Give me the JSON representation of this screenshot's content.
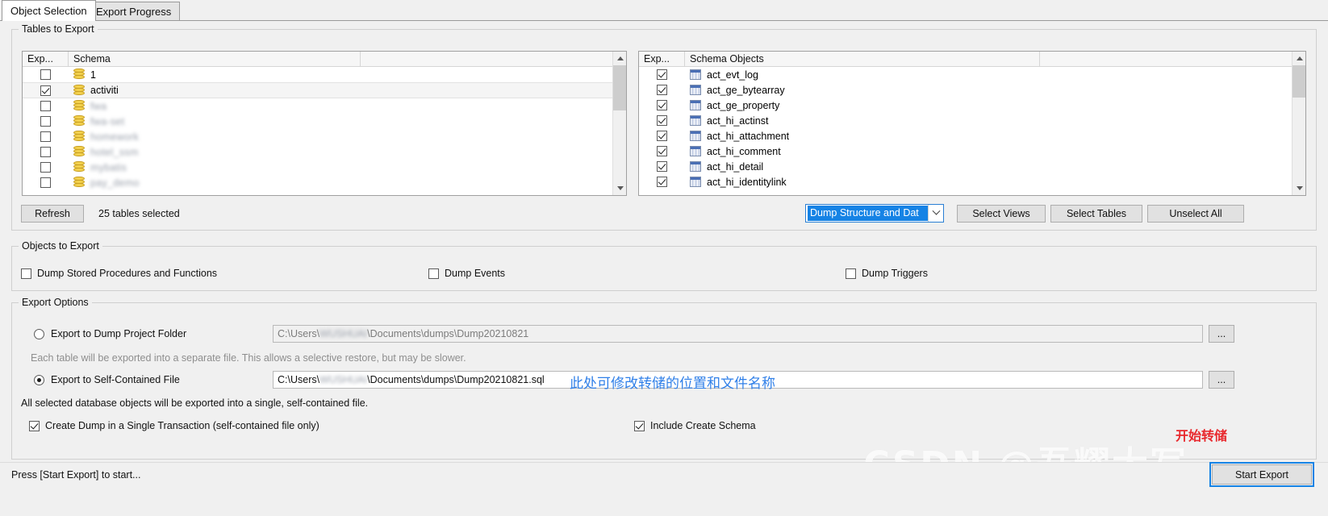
{
  "tabs": [
    {
      "label": "Object Selection",
      "active": true
    },
    {
      "label": "Export Progress",
      "active": false
    }
  ],
  "groups": {
    "tables_to_export": "Tables to Export",
    "objects_to_export": "Objects to Export",
    "export_options": "Export Options"
  },
  "schema_list": {
    "header_export": "Exp...",
    "header_name": "Schema",
    "rows": [
      {
        "name": "1",
        "checked": false,
        "selected": false,
        "blurred": false
      },
      {
        "name": "activiti",
        "checked": true,
        "selected": true,
        "blurred": false
      },
      {
        "name": "fwa",
        "checked": false,
        "selected": false,
        "blurred": true
      },
      {
        "name": "fwa-set",
        "checked": false,
        "selected": false,
        "blurred": true
      },
      {
        "name": "homework",
        "checked": false,
        "selected": false,
        "blurred": true
      },
      {
        "name": "hotel_ssm",
        "checked": false,
        "selected": false,
        "blurred": true
      },
      {
        "name": "mybatis",
        "checked": false,
        "selected": false,
        "blurred": true
      },
      {
        "name": "pay_demo",
        "checked": false,
        "selected": false,
        "blurred": true
      }
    ]
  },
  "objects_list": {
    "header_export": "Exp...",
    "header_name": "Schema Objects",
    "rows": [
      {
        "name": "act_evt_log",
        "checked": true
      },
      {
        "name": "act_ge_bytearray",
        "checked": true
      },
      {
        "name": "act_ge_property",
        "checked": true
      },
      {
        "name": "act_hi_actinst",
        "checked": true
      },
      {
        "name": "act_hi_attachment",
        "checked": true
      },
      {
        "name": "act_hi_comment",
        "checked": true
      },
      {
        "name": "act_hi_detail",
        "checked": true
      },
      {
        "name": "act_hi_identitylink",
        "checked": true
      }
    ]
  },
  "toolbar": {
    "refresh_label": "Refresh",
    "tables_selected": "25 tables selected",
    "dump_mode_value": "Dump Structure and Dat",
    "select_views_label": "Select Views",
    "select_tables_label": "Select Tables",
    "unselect_all_label": "Unselect All"
  },
  "objects_options": [
    {
      "label": "Dump Stored Procedures and Functions",
      "checked": false
    },
    {
      "label": "Dump Events",
      "checked": false
    },
    {
      "label": "Dump Triggers",
      "checked": false
    }
  ],
  "export_options": {
    "project_folder": {
      "radio_label": "Export to Dump Project Folder",
      "selected": false,
      "path_prefix": "C:\\Users\\",
      "path_user": "WUSHUAI",
      "path_suffix": "\\Documents\\dumps\\Dump20210821",
      "browse_label": "...",
      "help": "Each table will be exported into a separate file. This allows a selective restore, but may be slower."
    },
    "self_contained": {
      "radio_label": "Export to Self-Contained File",
      "selected": true,
      "path_prefix": "C:\\Users\\",
      "path_user": "WUSHUAI",
      "path_suffix": "\\Documents\\dumps\\Dump20210821.sql",
      "browse_label": "...",
      "help": "All selected database objects will be exported into a single, self-contained file."
    },
    "single_transaction": {
      "label": "Create Dump in a Single Transaction (self-contained file only)",
      "checked": true
    },
    "include_create_schema": {
      "label": "Include Create Schema",
      "checked": true
    }
  },
  "annotations": {
    "blue_note": "此处可修改转储的位置和文件名称",
    "red_note": "开始转储",
    "watermark": "CSDN @吾耀大写"
  },
  "footer": {
    "status": "Press [Start Export] to start...",
    "start_export_label": "Start Export"
  },
  "colors": {
    "accent_blue": "#1683e5",
    "anno_blue": "#2f7fe8",
    "anno_red": "#e8282d",
    "panel_bg": "#f0f0f0"
  }
}
